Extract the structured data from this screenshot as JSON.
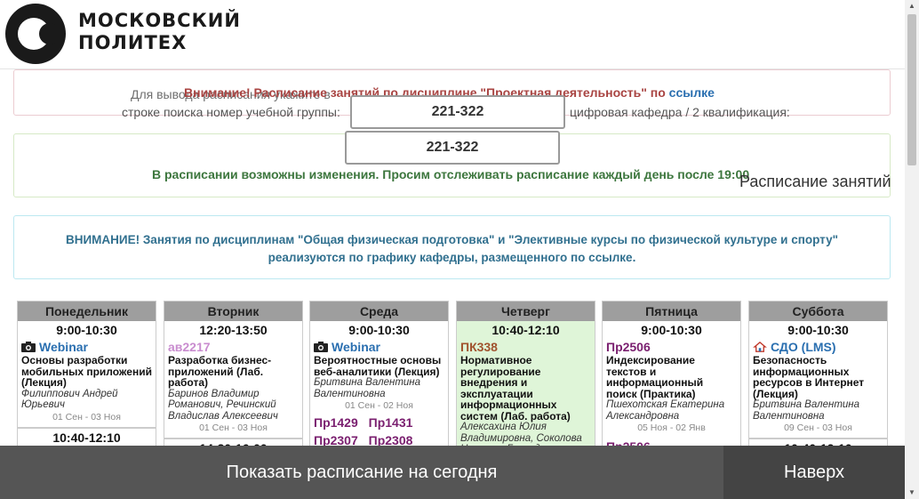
{
  "header": {
    "logo_line1": "МОСКОВСКИЙ",
    "logo_line2": "ПОЛИТЕХ"
  },
  "alerts": {
    "project_text": "Внимание! Расписание занятий по дисциплине \"Проектная деятельность\" по",
    "project_link": "ссылке",
    "hint_line1": "Для вывода расписания укажите в",
    "hint_line2_a": "строке поиска номер учебной группы:",
    "hint_line2_b": "цифровая кафедра / 2 квалификация:",
    "group_value_1": "221-322",
    "group_value_2": "221-322",
    "changes_text": "В расписании возможны изменения. Просим отслеживать расписание каждый день после 19:00",
    "schedule_title": "Расписание занятий",
    "pe_line1": "ВНИМАНИЕ! Занятия по дисциплинам \"Общая физическая подготовка\" и \"Элективные курсы по физической культуре и спорту\"",
    "pe_line2": "реализуются по графику кафедры, размещенного по ссылке."
  },
  "schedule": {
    "days": [
      {
        "name": "Понедельник",
        "time": "9:00-10:30",
        "room": "Webinar",
        "subject": "Основы разработки мобильных приложений (Лекция)",
        "teacher": "Филиппович Андрей Юрьевич",
        "dates": "01 Сен - 03 Ноя",
        "next_time": "10:40-12:10"
      },
      {
        "name": "Вторник",
        "time": "12:20-13:50",
        "room": "ав2217",
        "subject": "Разработка бизнес-приложений (Лаб. работа)",
        "teacher": "Баринов Владимир Романович, Речинский Владислав Алексеевич",
        "dates": "01 Сен - 03 Ноя",
        "next_time": "14:30-16:00"
      },
      {
        "name": "Среда",
        "time": "9:00-10:30",
        "room": "Webinar",
        "subject": "Вероятностные основы веб-аналитики (Лекция)",
        "teacher": "Бритвина Валентина Валентиновна",
        "dates": "01 Сен - 02 Ноя",
        "rooms": [
          "Пр1429",
          "Пр1431",
          "Пр2307",
          "Пр2308"
        ]
      },
      {
        "name": "Четверг",
        "time": "10:40-12:10",
        "room": "ПК338",
        "subject": "Нормативное регулирование внедрения и эксплуатации информационных систем (Лаб. работа)",
        "teacher": "Алексахина Юлия Владимировна, Соколова Наталья Геннадьевна"
      },
      {
        "name": "Пятница",
        "time": "9:00-10:30",
        "room": "Пр2506",
        "subject": "Индексирование текстов и информационный поиск (Практика)",
        "teacher": "Пшехотская Екатерина Александровна",
        "dates": "05 Ноя - 02 Янв",
        "next_room": "Пр2506"
      },
      {
        "name": "Суббота",
        "time": "9:00-10:30",
        "room": "СДО (LMS)",
        "subject": "Безопасность информационных ресурсов в Интернет (Лекция)",
        "teacher": "Бритвина Валентина Валентиновна",
        "dates": "09 Сен - 03 Ноя",
        "next_time": "10:40-12:10"
      }
    ]
  },
  "bottom": {
    "today_label": "Показать расписание на сегодня",
    "top_label": "Наверх"
  },
  "icons": {
    "webinar": "camera-icon",
    "lms": "home-icon",
    "scroll_up": "chevron-up-icon",
    "scroll_down": "chevron-down-icon"
  }
}
